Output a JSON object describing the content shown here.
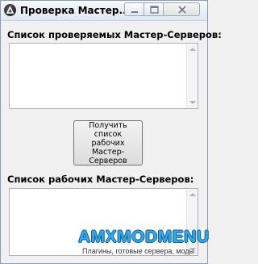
{
  "window": {
    "title": "Проверка Мастер...",
    "controls": {
      "minimize_icon": "minimize-icon",
      "maximize_icon": "maximize-icon",
      "close_icon": "close-icon"
    }
  },
  "sections": {
    "checked_label": "Список проверяемых Мастер-Серверов:",
    "working_label": "Список рабочих Мастер-Серверов:"
  },
  "button": {
    "label": "Получить список рабочих Мастер-Серверов"
  },
  "watermark": {
    "logo": "AMXMODMENU",
    "tagline": "Плагины, готовые сервера, моды"
  },
  "colors": {
    "accent": "#39a7e6",
    "window_bg": "#f0f0f0",
    "titlebar": "#dfe8f3"
  }
}
